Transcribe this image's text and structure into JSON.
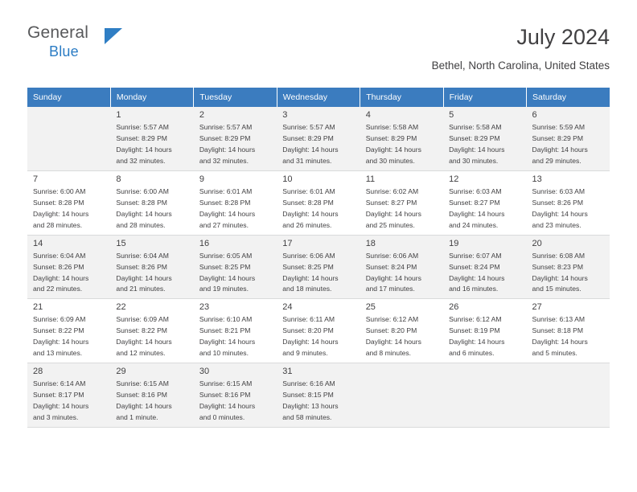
{
  "brand": {
    "name_top": "General",
    "name_bottom": "Blue",
    "flag_icon": "blue-triangle-flag-icon"
  },
  "header": {
    "title": "July 2024",
    "location": "Bethel, North Carolina, United States"
  },
  "calendar": {
    "weekday_headers": [
      "Sunday",
      "Monday",
      "Tuesday",
      "Wednesday",
      "Thursday",
      "Friday",
      "Saturday"
    ],
    "weeks": [
      [
        {
          "day": "",
          "lines": []
        },
        {
          "day": "1",
          "lines": [
            "Sunrise: 5:57 AM",
            "Sunset: 8:29 PM",
            "Daylight: 14 hours",
            "and 32 minutes."
          ]
        },
        {
          "day": "2",
          "lines": [
            "Sunrise: 5:57 AM",
            "Sunset: 8:29 PM",
            "Daylight: 14 hours",
            "and 32 minutes."
          ]
        },
        {
          "day": "3",
          "lines": [
            "Sunrise: 5:57 AM",
            "Sunset: 8:29 PM",
            "Daylight: 14 hours",
            "and 31 minutes."
          ]
        },
        {
          "day": "4",
          "lines": [
            "Sunrise: 5:58 AM",
            "Sunset: 8:29 PM",
            "Daylight: 14 hours",
            "and 30 minutes."
          ]
        },
        {
          "day": "5",
          "lines": [
            "Sunrise: 5:58 AM",
            "Sunset: 8:29 PM",
            "Daylight: 14 hours",
            "and 30 minutes."
          ]
        },
        {
          "day": "6",
          "lines": [
            "Sunrise: 5:59 AM",
            "Sunset: 8:29 PM",
            "Daylight: 14 hours",
            "and 29 minutes."
          ]
        }
      ],
      [
        {
          "day": "7",
          "lines": [
            "Sunrise: 6:00 AM",
            "Sunset: 8:28 PM",
            "Daylight: 14 hours",
            "and 28 minutes."
          ]
        },
        {
          "day": "8",
          "lines": [
            "Sunrise: 6:00 AM",
            "Sunset: 8:28 PM",
            "Daylight: 14 hours",
            "and 28 minutes."
          ]
        },
        {
          "day": "9",
          "lines": [
            "Sunrise: 6:01 AM",
            "Sunset: 8:28 PM",
            "Daylight: 14 hours",
            "and 27 minutes."
          ]
        },
        {
          "day": "10",
          "lines": [
            "Sunrise: 6:01 AM",
            "Sunset: 8:28 PM",
            "Daylight: 14 hours",
            "and 26 minutes."
          ]
        },
        {
          "day": "11",
          "lines": [
            "Sunrise: 6:02 AM",
            "Sunset: 8:27 PM",
            "Daylight: 14 hours",
            "and 25 minutes."
          ]
        },
        {
          "day": "12",
          "lines": [
            "Sunrise: 6:03 AM",
            "Sunset: 8:27 PM",
            "Daylight: 14 hours",
            "and 24 minutes."
          ]
        },
        {
          "day": "13",
          "lines": [
            "Sunrise: 6:03 AM",
            "Sunset: 8:26 PM",
            "Daylight: 14 hours",
            "and 23 minutes."
          ]
        }
      ],
      [
        {
          "day": "14",
          "lines": [
            "Sunrise: 6:04 AM",
            "Sunset: 8:26 PM",
            "Daylight: 14 hours",
            "and 22 minutes."
          ]
        },
        {
          "day": "15",
          "lines": [
            "Sunrise: 6:04 AM",
            "Sunset: 8:26 PM",
            "Daylight: 14 hours",
            "and 21 minutes."
          ]
        },
        {
          "day": "16",
          "lines": [
            "Sunrise: 6:05 AM",
            "Sunset: 8:25 PM",
            "Daylight: 14 hours",
            "and 19 minutes."
          ]
        },
        {
          "day": "17",
          "lines": [
            "Sunrise: 6:06 AM",
            "Sunset: 8:25 PM",
            "Daylight: 14 hours",
            "and 18 minutes."
          ]
        },
        {
          "day": "18",
          "lines": [
            "Sunrise: 6:06 AM",
            "Sunset: 8:24 PM",
            "Daylight: 14 hours",
            "and 17 minutes."
          ]
        },
        {
          "day": "19",
          "lines": [
            "Sunrise: 6:07 AM",
            "Sunset: 8:24 PM",
            "Daylight: 14 hours",
            "and 16 minutes."
          ]
        },
        {
          "day": "20",
          "lines": [
            "Sunrise: 6:08 AM",
            "Sunset: 8:23 PM",
            "Daylight: 14 hours",
            "and 15 minutes."
          ]
        }
      ],
      [
        {
          "day": "21",
          "lines": [
            "Sunrise: 6:09 AM",
            "Sunset: 8:22 PM",
            "Daylight: 14 hours",
            "and 13 minutes."
          ]
        },
        {
          "day": "22",
          "lines": [
            "Sunrise: 6:09 AM",
            "Sunset: 8:22 PM",
            "Daylight: 14 hours",
            "and 12 minutes."
          ]
        },
        {
          "day": "23",
          "lines": [
            "Sunrise: 6:10 AM",
            "Sunset: 8:21 PM",
            "Daylight: 14 hours",
            "and 10 minutes."
          ]
        },
        {
          "day": "24",
          "lines": [
            "Sunrise: 6:11 AM",
            "Sunset: 8:20 PM",
            "Daylight: 14 hours",
            "and 9 minutes."
          ]
        },
        {
          "day": "25",
          "lines": [
            "Sunrise: 6:12 AM",
            "Sunset: 8:20 PM",
            "Daylight: 14 hours",
            "and 8 minutes."
          ]
        },
        {
          "day": "26",
          "lines": [
            "Sunrise: 6:12 AM",
            "Sunset: 8:19 PM",
            "Daylight: 14 hours",
            "and 6 minutes."
          ]
        },
        {
          "day": "27",
          "lines": [
            "Sunrise: 6:13 AM",
            "Sunset: 8:18 PM",
            "Daylight: 14 hours",
            "and 5 minutes."
          ]
        }
      ],
      [
        {
          "day": "28",
          "lines": [
            "Sunrise: 6:14 AM",
            "Sunset: 8:17 PM",
            "Daylight: 14 hours",
            "and 3 minutes."
          ]
        },
        {
          "day": "29",
          "lines": [
            "Sunrise: 6:15 AM",
            "Sunset: 8:16 PM",
            "Daylight: 14 hours",
            "and 1 minute."
          ]
        },
        {
          "day": "30",
          "lines": [
            "Sunrise: 6:15 AM",
            "Sunset: 8:16 PM",
            "Daylight: 14 hours",
            "and 0 minutes."
          ]
        },
        {
          "day": "31",
          "lines": [
            "Sunrise: 6:16 AM",
            "Sunset: 8:15 PM",
            "Daylight: 13 hours",
            "and 58 minutes."
          ]
        },
        {
          "day": "",
          "lines": []
        },
        {
          "day": "",
          "lines": []
        },
        {
          "day": "",
          "lines": []
        }
      ]
    ]
  },
  "colors": {
    "header_blue": "#3b7cbf",
    "shaded_row": "#f2f2f2",
    "text": "#414042",
    "logo_blue": "#2b7cc4"
  }
}
